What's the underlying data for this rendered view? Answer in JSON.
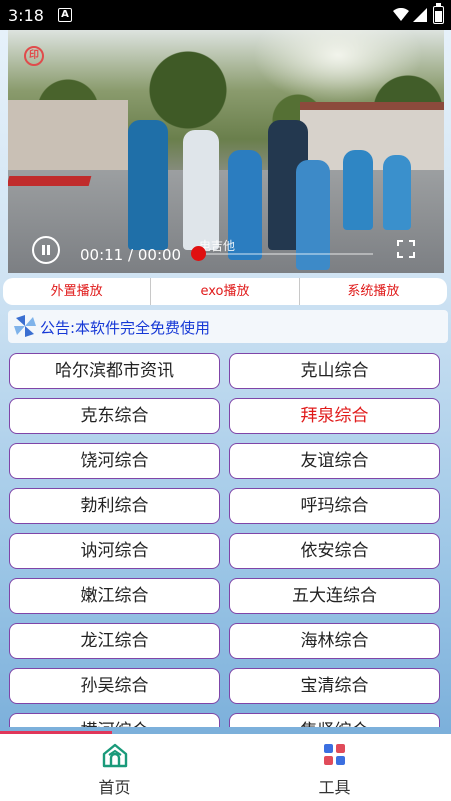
{
  "status_bar": {
    "time": "3:18",
    "notification_icon": "A"
  },
  "player": {
    "logo_glyph": "印",
    "current_time": "00:11",
    "separator": "/",
    "duration": "00:00",
    "watermark": "电吉他",
    "progress": 0.0
  },
  "player_options": [
    "外置播放",
    "exo播放",
    "系统播放"
  ],
  "announcement": {
    "text": "公告:本软件完全免费使用",
    "icon": "pinwheel-icon"
  },
  "channels": [
    {
      "label": "哈尔滨都市资讯"
    },
    {
      "label": "克山综合"
    },
    {
      "label": "克东综合"
    },
    {
      "label": "拜泉综合",
      "active": true
    },
    {
      "label": "饶河综合"
    },
    {
      "label": "友谊综合"
    },
    {
      "label": "勃利综合"
    },
    {
      "label": "呼玛综合"
    },
    {
      "label": "讷河综合"
    },
    {
      "label": "依安综合"
    },
    {
      "label": "嫩江综合"
    },
    {
      "label": "五大连综合"
    },
    {
      "label": "龙江综合"
    },
    {
      "label": "海林综合"
    },
    {
      "label": "孙吴综合"
    },
    {
      "label": "宝清综合"
    },
    {
      "label": "横河综合"
    },
    {
      "label": "集贤综合"
    }
  ],
  "bottom_nav": [
    {
      "label": "首页",
      "icon": "home-icon",
      "active": true
    },
    {
      "label": "工具",
      "icon": "tools-icon"
    }
  ],
  "colors": {
    "accent_red": "#e01b1b",
    "announce_blue": "#1638d6",
    "tab_indicator": "#e0365a",
    "button_border": "#7f45a8"
  }
}
